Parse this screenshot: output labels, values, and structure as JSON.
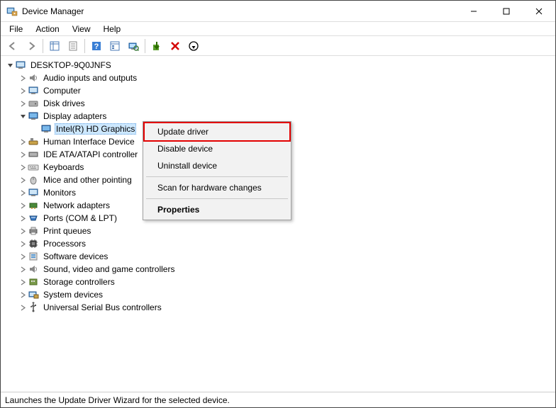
{
  "window": {
    "title": "Device Manager"
  },
  "menu": {
    "file": "File",
    "action": "Action",
    "view": "View",
    "help": "Help"
  },
  "root": {
    "label": "DESKTOP-9Q0JNFS"
  },
  "categories": {
    "audio": "Audio inputs and outputs",
    "computer": "Computer",
    "disk": "Disk drives",
    "display": "Display adapters",
    "display_child": "Intel(R) HD Graphics",
    "hid": "Human Interface Device",
    "ide": "IDE ATA/ATAPI controller",
    "keyboards": "Keyboards",
    "mice": "Mice and other pointing",
    "monitors": "Monitors",
    "network": "Network adapters",
    "ports": "Ports (COM & LPT)",
    "printq": "Print queues",
    "processors": "Processors",
    "softdev": "Software devices",
    "sound": "Sound, video and game controllers",
    "storage": "Storage controllers",
    "sysdev": "System devices",
    "usb": "Universal Serial Bus controllers"
  },
  "context": {
    "update": "Update driver",
    "disable": "Disable device",
    "uninstall": "Uninstall device",
    "scan": "Scan for hardware changes",
    "properties": "Properties"
  },
  "status": {
    "text": "Launches the Update Driver Wizard for the selected device."
  }
}
